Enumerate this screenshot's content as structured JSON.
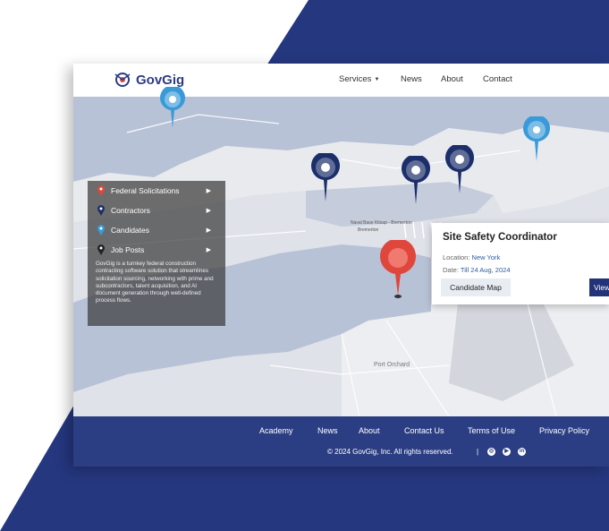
{
  "header": {
    "brand": "GovGig",
    "nav": [
      {
        "label": "Services",
        "has_caret": true
      },
      {
        "label": "News"
      },
      {
        "label": "About"
      },
      {
        "label": "Contact"
      }
    ]
  },
  "map": {
    "labels": [
      "Naval Base Kitsap - Bremerton",
      "Port Orchard",
      "Bremerton"
    ]
  },
  "legend": {
    "items": [
      {
        "label": "Federal Solicitations",
        "color": "#e0473c"
      },
      {
        "label": "Contractors",
        "color": "#1c2f6b"
      },
      {
        "label": "Candidates",
        "color": "#3a9ad9"
      },
      {
        "label": "Job Posts",
        "color": "#222222"
      }
    ],
    "description": "GovGig is a turnkey federal construction contracting software solution that streamlines solicitation sourcing, networking with prime and subcontractors, talent acquisition, and AI document generation through well-defined process flows."
  },
  "job_card": {
    "title": "Site Safety Coordinator",
    "location_label": "Location:",
    "location_value": "New York",
    "date_label": "Date:",
    "date_value": "Till 24 Aug, 2024",
    "candidate_button": "Candidate Map",
    "view_button": "View"
  },
  "footer": {
    "links": [
      "Academy",
      "News",
      "About",
      "Contact Us",
      "Terms of Use",
      "Privacy Policy"
    ],
    "copyright": "© 2024 GovGig, Inc. All rights reserved.",
    "separator": "|"
  },
  "colors": {
    "brand_navy": "#2c3e83",
    "pin_red": "#e0473c",
    "pin_navy": "#1c2f6b",
    "pin_light_blue": "#3a9ad9",
    "water": "#b8c2d6"
  }
}
